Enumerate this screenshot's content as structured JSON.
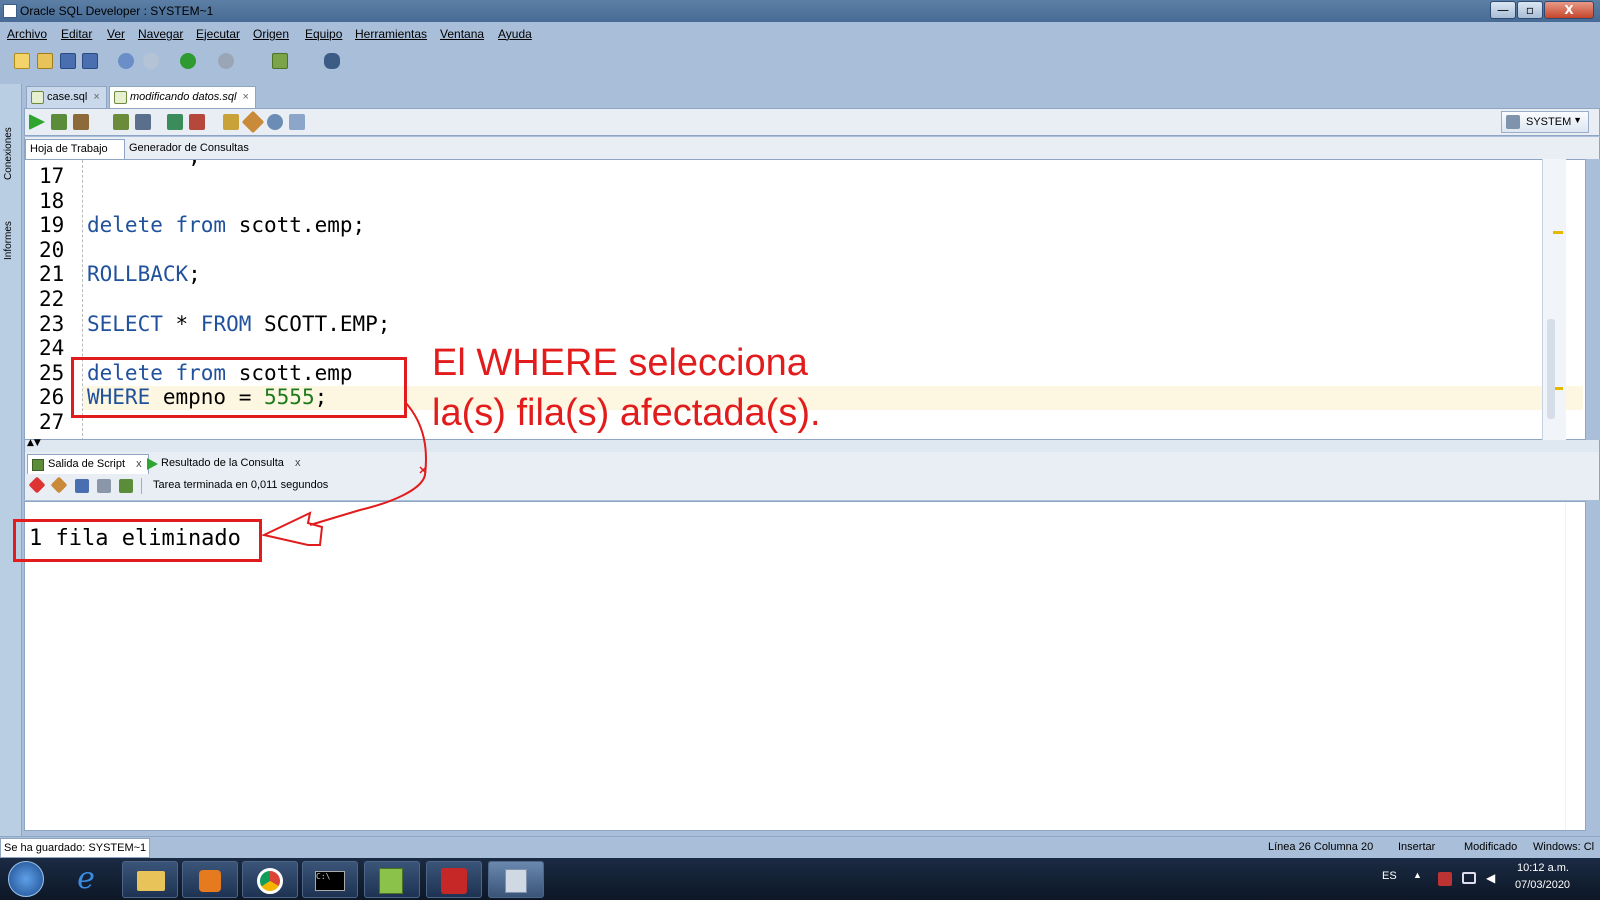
{
  "window": {
    "title": "Oracle SQL Developer : SYSTEM~1",
    "min_label": "—",
    "max_label": "▫",
    "close_label": "X"
  },
  "menu": [
    "Archivo",
    "Editar",
    "Ver",
    "Navegar",
    "Ejecutar",
    "Origen",
    "Equipo",
    "Herramientas",
    "Ventana",
    "Ayuda"
  ],
  "left_strip": {
    "connections": "Conexiones",
    "reports": "Informes"
  },
  "doc_tabs": [
    {
      "label": "case.sql",
      "close": "×"
    },
    {
      "label": "modificando datos.sql",
      "close": "×"
    }
  ],
  "connection_selector": "SYSTEM",
  "sub_tabs": [
    "Hoja de Trabajo",
    "Generador de Consultas"
  ],
  "editor": {
    "lines": [
      {
        "n": "17",
        "code": []
      },
      {
        "n": "18",
        "code": []
      },
      {
        "n": "19",
        "code": [
          {
            "t": "delete from",
            "k": "kw"
          },
          {
            "t": " scott.emp;",
            "k": ""
          }
        ]
      },
      {
        "n": "20",
        "code": []
      },
      {
        "n": "21",
        "code": [
          {
            "t": "ROLLBACK",
            "k": "kw"
          },
          {
            "t": ";",
            "k": ""
          }
        ]
      },
      {
        "n": "22",
        "code": []
      },
      {
        "n": "23",
        "code": [
          {
            "t": "SELECT",
            "k": "kw"
          },
          {
            "t": " * ",
            "k": ""
          },
          {
            "t": "FROM",
            "k": "kw"
          },
          {
            "t": " SCOTT.EMP;",
            "k": ""
          }
        ]
      },
      {
        "n": "24",
        "code": []
      },
      {
        "n": "25",
        "code": [
          {
            "t": "delete from",
            "k": "kw"
          },
          {
            "t": " scott.emp",
            "k": ""
          }
        ]
      },
      {
        "n": "26",
        "code": [
          {
            "t": "WHERE",
            "k": "kw"
          },
          {
            "t": " empno = ",
            "k": ""
          },
          {
            "t": "5555",
            "k": "num"
          },
          {
            "t": ";",
            "k": ""
          }
        ]
      },
      {
        "n": "27",
        "code": []
      }
    ],
    "partial_top": "        ;"
  },
  "output_tabs": [
    {
      "label": "Salida de Script",
      "close": "x"
    },
    {
      "label": "Resultado de la Consulta",
      "close": "x"
    }
  ],
  "output_status": "Tarea terminada en 0,011 segundos",
  "output_text": "1 fila eliminado",
  "annotation": {
    "line1": "El WHERE selecciona",
    "line2": "la(s) fila(s) afectada(s).",
    "color": "#e21c1c"
  },
  "status_bar": {
    "saved": "Se ha guardado: SYSTEM~1",
    "position": "Línea 26 Columna 20",
    "mode": "Insertar",
    "modified": "Modificado",
    "line_ending": "Windows: Cl"
  },
  "taskbar": {
    "language": "ES",
    "time": "10:12 a.m.",
    "date": "07/03/2020"
  },
  "colors": {
    "keyword": "#20519c",
    "number": "#1d7a1d",
    "chrome": "#a9bfd9"
  }
}
